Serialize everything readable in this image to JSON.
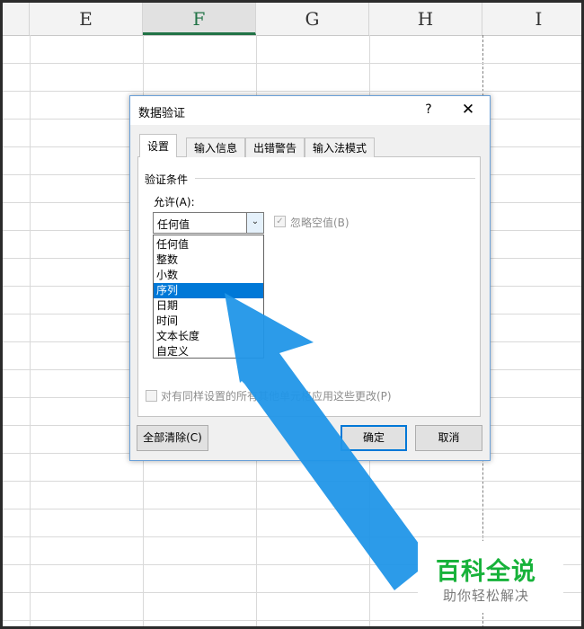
{
  "sheet": {
    "columns": [
      {
        "label": "E",
        "selected": false
      },
      {
        "label": "F",
        "selected": true
      },
      {
        "label": "G",
        "selected": false
      },
      {
        "label": "H",
        "selected": false
      },
      {
        "label": "I",
        "selected": false
      }
    ]
  },
  "dialog": {
    "title": "数据验证",
    "help": "?",
    "close": "✕",
    "tabs": [
      "设置",
      "输入信息",
      "出错警告",
      "输入法模式"
    ],
    "active_tab": "设置",
    "group_label": "验证条件",
    "allow_label": "允许(A):",
    "allow_value": "任何值",
    "ignore_blank_label": "忽略空值(B)",
    "ignore_blank_checked": true,
    "dropdown_options": [
      "任何值",
      "整数",
      "小数",
      "序列",
      "日期",
      "时间",
      "文本长度",
      "自定义"
    ],
    "dropdown_highlighted": "序列",
    "apply_all_label": "对有同样设置的所有其他单元格应用这些更改(P)",
    "buttons": {
      "clear_all": "全部清除(C)",
      "ok": "确定",
      "cancel": "取消"
    }
  },
  "annotation": {
    "arrow_color": "#2196e8"
  },
  "watermark": {
    "title": "百科全说",
    "subtitle": "助你轻松解决",
    "title_color": "#17b23a"
  }
}
